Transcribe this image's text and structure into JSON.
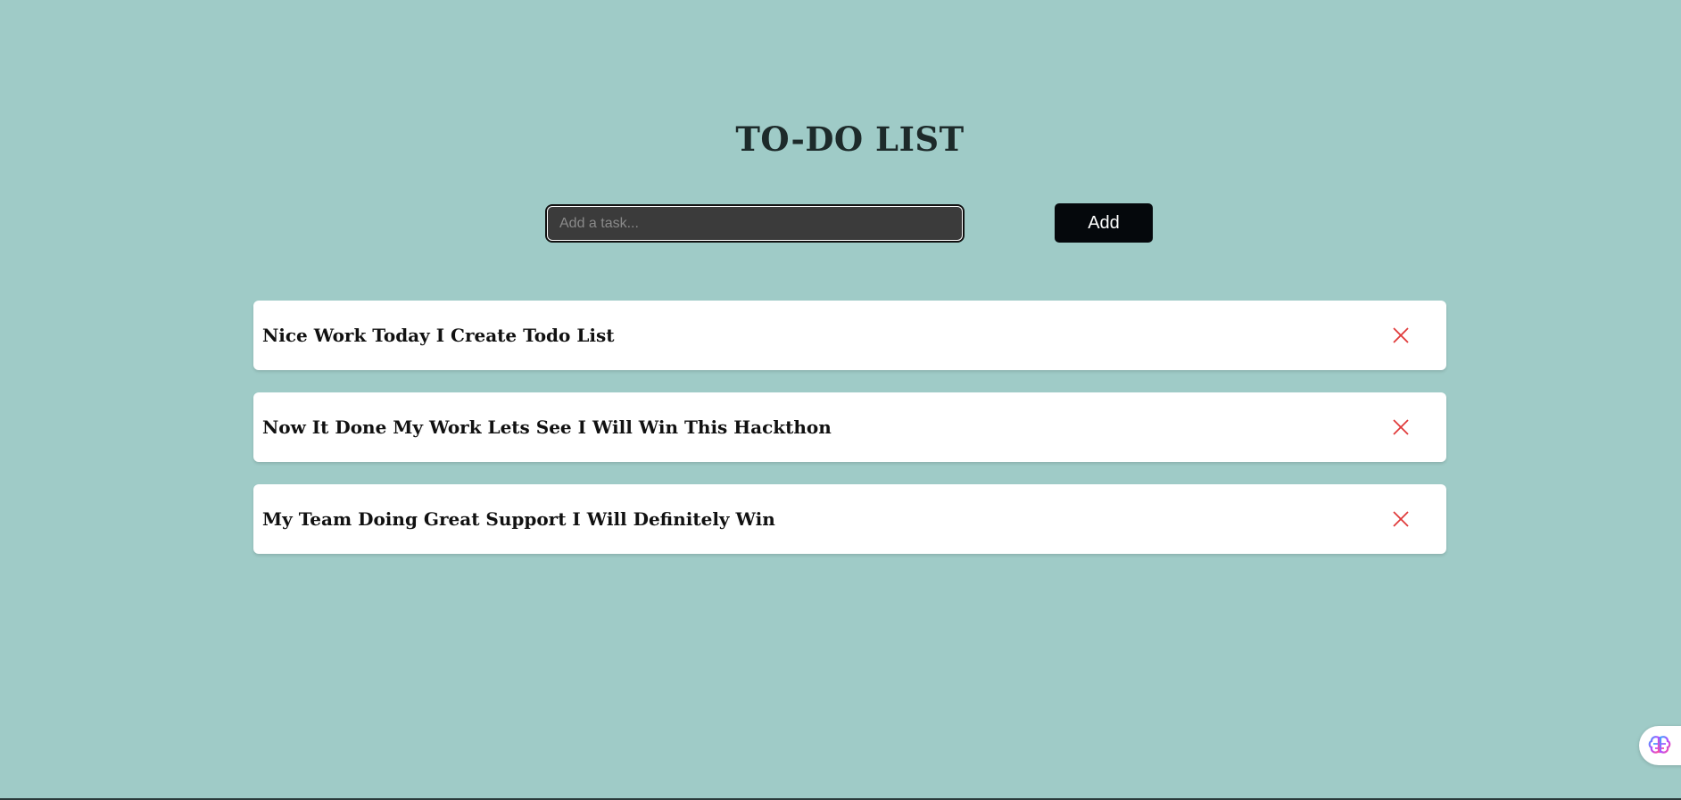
{
  "header": {
    "title": "TO-DO LIST"
  },
  "input": {
    "placeholder": "Add a task...",
    "value": ""
  },
  "add_button": {
    "label": "Add"
  },
  "tasks": [
    {
      "text": "Nice Work Today I Create Todo List",
      "delete_icon": "close-icon"
    },
    {
      "text": "Now It Done My Work Lets See I Will Win This Hackthon",
      "delete_icon": "close-icon"
    },
    {
      "text": "My Team Doing Great Support I Will Definitely Win",
      "delete_icon": "close-icon"
    }
  ],
  "extension_widget": {
    "icon": "brain-icon"
  },
  "colors": {
    "background": "#9fcbc7",
    "input_background": "#3b3b3b",
    "add_button_background": "#05080c",
    "delete_icon": "#e03a3a",
    "card_background": "#ffffff"
  }
}
